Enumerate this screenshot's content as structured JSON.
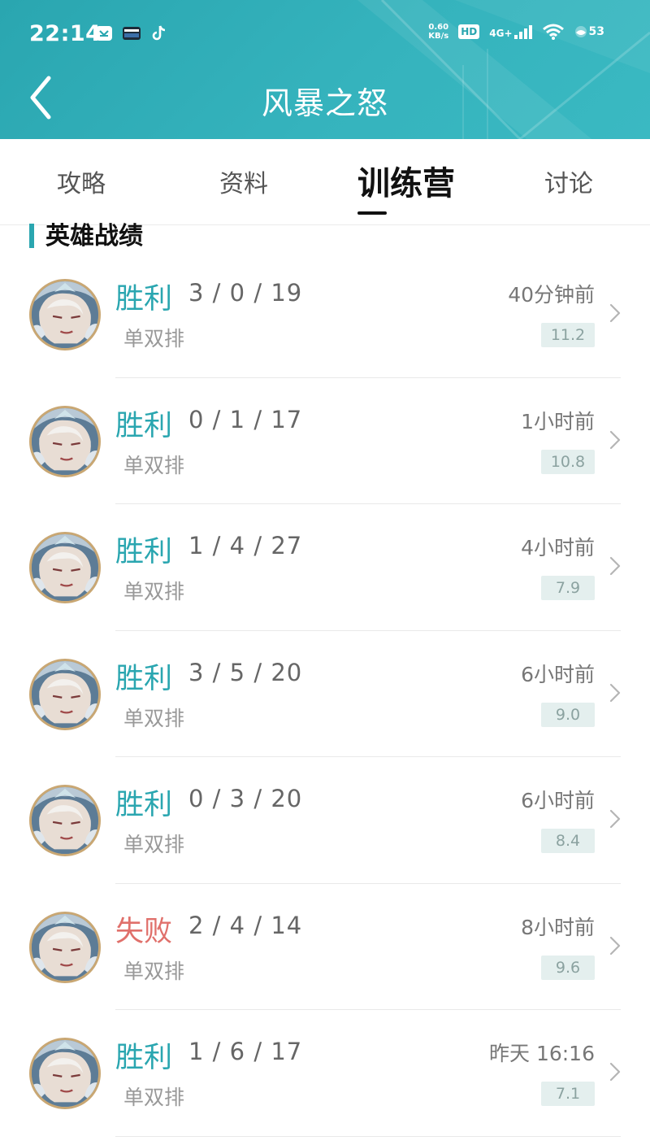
{
  "status_bar": {
    "time": "22:14",
    "net_speed_value": "0.60",
    "net_speed_unit": "KB/s",
    "hd_label": "HD",
    "signal_label": "4G+",
    "battery_level": "53"
  },
  "header": {
    "title": "风暴之怒",
    "accent_color": "#2aa6b0"
  },
  "tabs": [
    {
      "label": "攻略",
      "active": false
    },
    {
      "label": "资料",
      "active": false
    },
    {
      "label": "训练营",
      "active": true
    },
    {
      "label": "讨论",
      "active": false
    }
  ],
  "section": {
    "title": "英雄战绩"
  },
  "matches": [
    {
      "result": "胜利",
      "kda": "3 / 0 / 19",
      "mode": "单双排",
      "time": "40分钟前",
      "score": "11.2"
    },
    {
      "result": "胜利",
      "kda": "0 / 1 / 17",
      "mode": "单双排",
      "time": "1小时前",
      "score": "10.8"
    },
    {
      "result": "胜利",
      "kda": "1 / 4 / 27",
      "mode": "单双排",
      "time": "4小时前",
      "score": "7.9"
    },
    {
      "result": "胜利",
      "kda": "3 / 5 / 20",
      "mode": "单双排",
      "time": "6小时前",
      "score": "9.0"
    },
    {
      "result": "胜利",
      "kda": "0 / 3 / 20",
      "mode": "单双排",
      "time": "6小时前",
      "score": "8.4"
    },
    {
      "result": "失败",
      "kda": "2 / 4 / 14",
      "mode": "单双排",
      "time": "8小时前",
      "score": "9.6"
    },
    {
      "result": "胜利",
      "kda": "1 / 6 / 17",
      "mode": "单双排",
      "time": "昨天 16:16",
      "score": "7.1"
    }
  ]
}
